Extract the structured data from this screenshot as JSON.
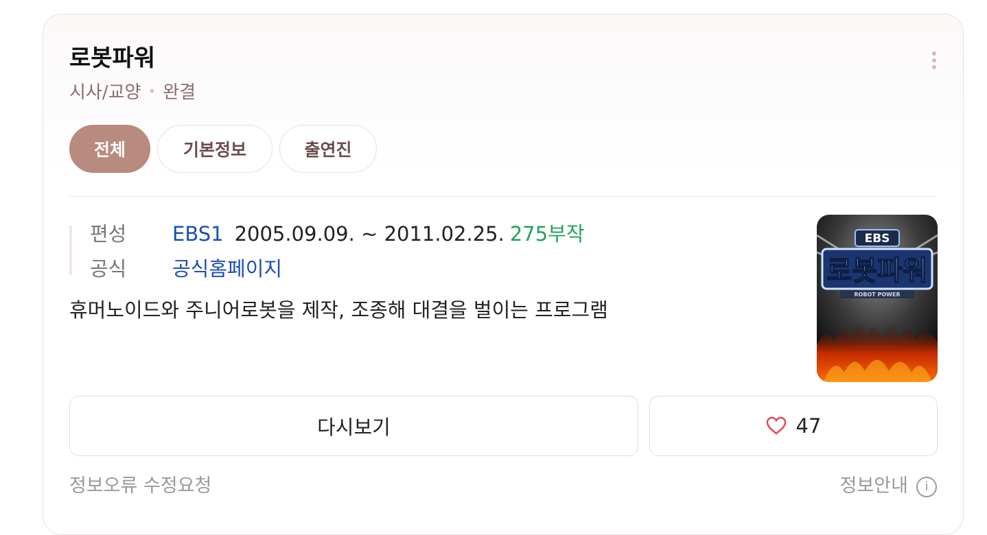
{
  "program": {
    "title": "로봇파워",
    "genre": "시사/교양",
    "status": "완결"
  },
  "tabs": [
    {
      "label": "전체",
      "active": true
    },
    {
      "label": "기본정보",
      "active": false
    },
    {
      "label": "출연진",
      "active": false
    }
  ],
  "info": {
    "broadcast_label": "편성",
    "channel": "EBS1",
    "period": "2005.09.09. ~ 2011.02.25.",
    "episodes": "275부작",
    "official_label": "공식",
    "homepage": "공식홈페이지"
  },
  "description": "휴머노이드와 주니어로봇을 제작, 조종해 대결을 벌이는 프로그램",
  "poster": {
    "logo_lettering": "EBS 로봇파워 ROBOT POWER"
  },
  "actions": {
    "replay_label": "다시보기",
    "like_count": "47"
  },
  "footer": {
    "report_label": "정보오류 수정요청",
    "info_label": "정보안내"
  },
  "icons": {
    "like": "heart-icon",
    "more": "more-vertical-icon",
    "info": "info-circle-icon"
  },
  "colors": {
    "accent": "#b98a7e",
    "link": "#1a4fb5",
    "episodes": "#21a35a",
    "heart": "#e5484d"
  }
}
